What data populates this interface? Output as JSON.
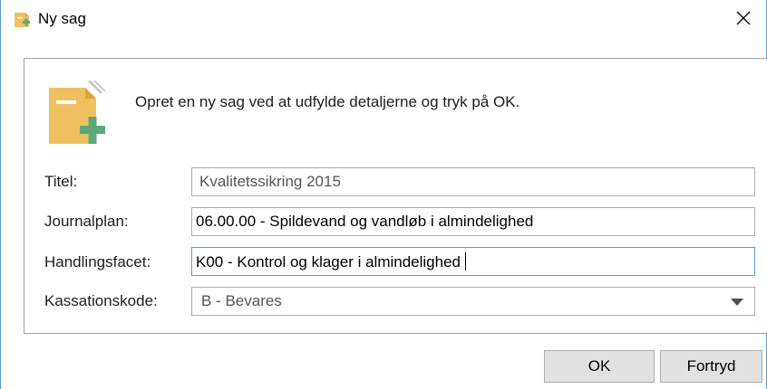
{
  "window": {
    "title": "Ny sag",
    "icons": {
      "title": "new-case-icon",
      "close": "close-icon",
      "big": "new-case-document-icon"
    }
  },
  "intro": "Opret en ny sag ved at udfylde detaljerne og tryk på OK.",
  "form": {
    "titel": {
      "label": "Titel:",
      "value": "Kvalitetssikring 2015"
    },
    "journalplan": {
      "label": "Journalplan:",
      "value": "06.00.00 - Spildevand og vandløb i almindelighed"
    },
    "handlingsfacet": {
      "label": "Handlingsfacet:",
      "value": "K00 - Kontrol og klager i almindelighed"
    },
    "kassationskode": {
      "label": "Kassationskode:",
      "value": "B - Bevares"
    }
  },
  "buttons": {
    "ok": "OK",
    "cancel": "Fortryd"
  },
  "colors": {
    "icon_yellow": "#f0c060",
    "icon_green": "#5aa977",
    "focus_border": "#569de5"
  }
}
